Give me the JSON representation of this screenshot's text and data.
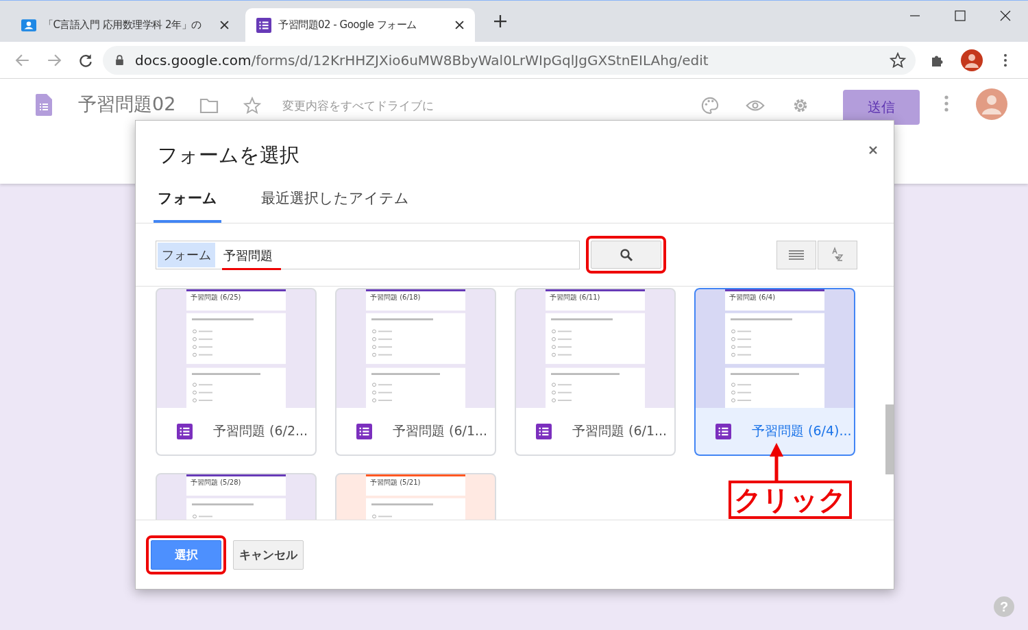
{
  "browser": {
    "tabs": [
      {
        "title": "「C言語入門 応用数理学科 2年」の",
        "kind": "classroom",
        "selected": false
      },
      {
        "title": "予習問題02 - Google フォーム",
        "kind": "forms",
        "selected": true
      }
    ],
    "url_host": "docs.google.com",
    "url_path": "/forms/d/12KrHHZJXio6uMW8BbyWal0LrWIpGqlJgGXStnEILAhg/edit"
  },
  "app": {
    "title": "予習問題02",
    "save_status": "変更内容をすべてドライブに",
    "send_label": "送信"
  },
  "dialog": {
    "title": "フォームを選択",
    "tabs": [
      {
        "label": "フォーム",
        "selected": true
      },
      {
        "label": "最近選択したアイテム",
        "selected": false
      }
    ],
    "search": {
      "chip": "フォーム",
      "value": "予習問題",
      "underlined": true
    },
    "search_button": {
      "highlighted": true
    },
    "files": [
      {
        "name": "予習問題 (6/2...",
        "thumb_title": "予習問題 (6/25)",
        "color": "#673ab7",
        "selected": false
      },
      {
        "name": "予習問題 (6/1...",
        "thumb_title": "予習問題 (6/18)",
        "color": "#673ab7",
        "selected": false
      },
      {
        "name": "予習問題 (6/1...",
        "thumb_title": "予習問題 (6/11)",
        "color": "#673ab7",
        "selected": false
      },
      {
        "name": "予習問題 (6/4)...",
        "thumb_title": "予習問題 (6/4)",
        "color": "#673ab7",
        "selected": true
      },
      {
        "thumb_title": "予習問題 (5/28)",
        "color": "#673ab7",
        "selected": false
      },
      {
        "thumb_title": "予習問題 (5/21)",
        "color": "#ff5722",
        "selected": false
      }
    ],
    "buttons": [
      {
        "label": "選択",
        "kind": "primary",
        "highlighted": true
      },
      {
        "label": "キャンセル",
        "kind": "secondary",
        "highlighted": false
      }
    ]
  },
  "annotation": {
    "text": "クリック"
  },
  "help_label": "?"
}
